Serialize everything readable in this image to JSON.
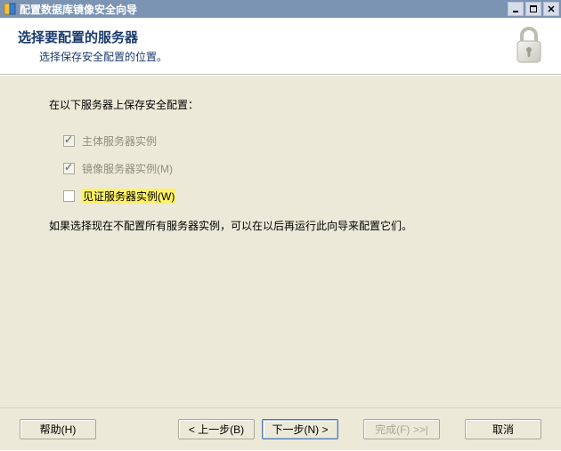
{
  "window": {
    "title": "配置数据库镜像安全向导"
  },
  "header": {
    "title": "选择要配置的服务器",
    "subtitle": "选择保存安全配置的位置。"
  },
  "content": {
    "intro": "在以下服务器上保存安全配置：",
    "principal_label": "主体服务器实例",
    "mirror_label": "镜像服务器实例(M)",
    "witness_label": "见证服务器实例(W)",
    "note": "如果选择现在不配置所有服务器实例，可以在以后再运行此向导来配置它们。"
  },
  "buttons": {
    "help": "帮助(H)",
    "back": "< 上一步(B)",
    "next": "下一步(N) >",
    "finish": "完成(F) >>|",
    "cancel": "取消"
  },
  "icons": {
    "app": "app-icon",
    "lock": "lock-icon",
    "minimize": "minimize-icon",
    "maximize": "maximize-icon",
    "close": "close-icon"
  }
}
